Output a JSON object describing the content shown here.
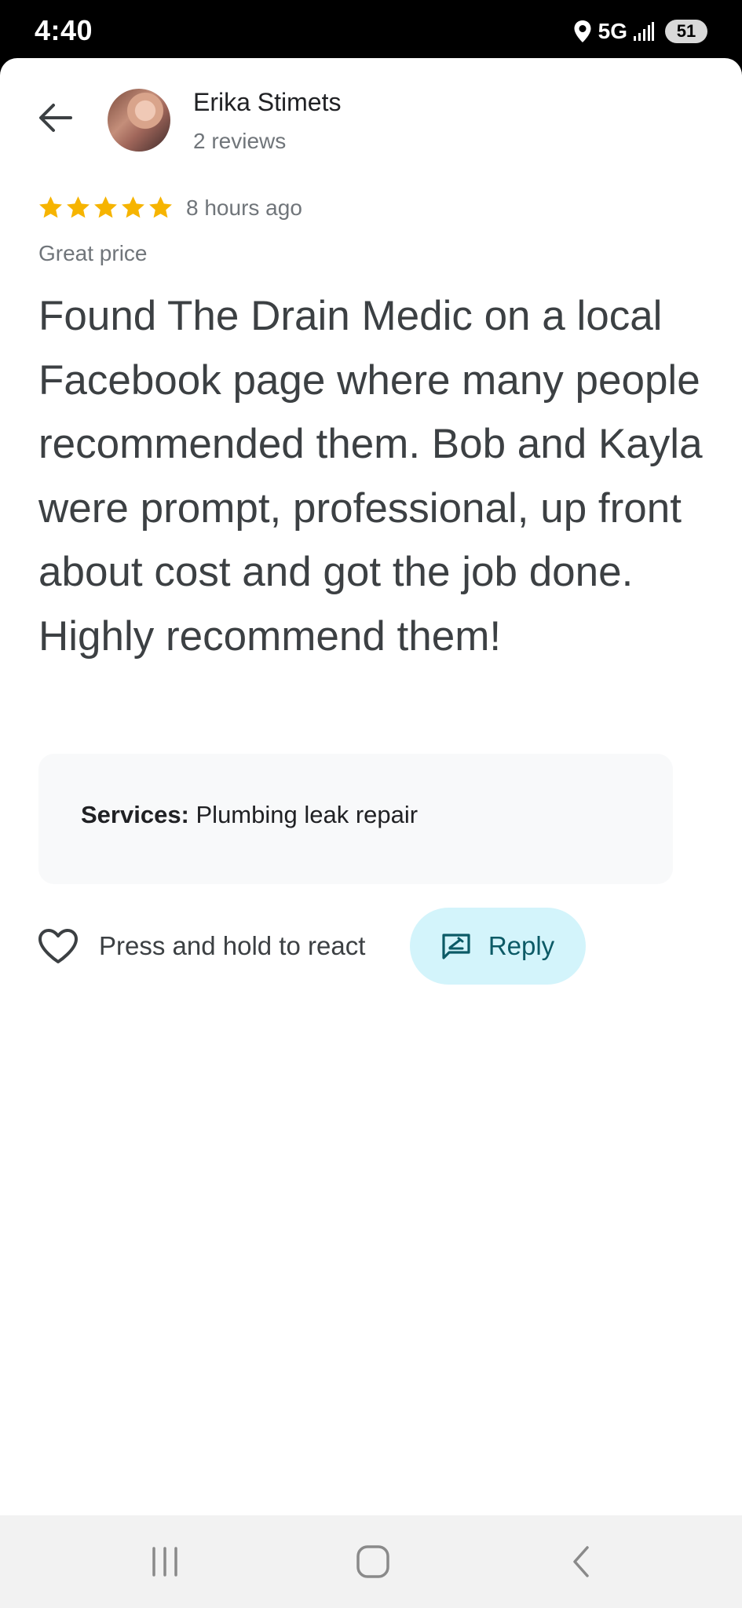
{
  "status_bar": {
    "time": "4:40",
    "network": "5G",
    "battery": "51",
    "icons": [
      "location-icon",
      "signal-icon"
    ]
  },
  "header": {
    "back_icon": "arrow-left-icon",
    "reviewer_name": "Erika Stimets",
    "review_count": "2 reviews"
  },
  "review": {
    "rating": 5,
    "rating_max": 5,
    "time_ago": "8 hours ago",
    "tag": "Great price",
    "text": "Found The Drain Medic on a local Facebook page where many people recommended them. Bob and Kayla were prompt, professional, up front about cost and got the job done. Highly recommend them!",
    "services_key": "Services:",
    "services_value": " Plumbing leak repair"
  },
  "actions": {
    "react_label": "Press and hold to react",
    "reply_label": "Reply",
    "colors": {
      "star": "#f6b400",
      "reply_bg": "#d3f4fb",
      "reply_text": "#0b5a66"
    }
  },
  "nav_bar": {
    "items": [
      "recent-apps-icon",
      "home-icon",
      "back-icon"
    ]
  }
}
